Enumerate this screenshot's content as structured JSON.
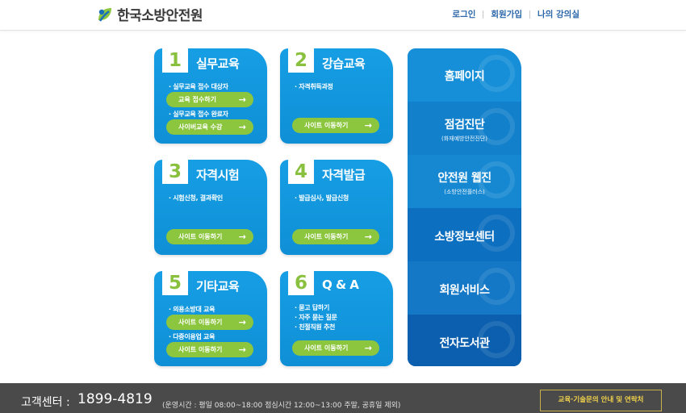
{
  "header": {
    "logo_text": "한국소방안전원",
    "nav": [
      "로그인",
      "회원가입",
      "나의 강의실"
    ]
  },
  "tiles": [
    {
      "num": "1",
      "title": "실무교육",
      "bullets": [
        "실무교육 접수 대상자",
        "실무교육 접수 완료자"
      ],
      "buttons": [
        "교육 접수하기",
        "사이버교육 수강"
      ]
    },
    {
      "num": "2",
      "title": "강습교육",
      "bullets": [
        "자격취득과정"
      ],
      "buttons": [
        "사이트 이동하기"
      ]
    },
    {
      "num": "3",
      "title": "자격시험",
      "bullets": [
        "시험신청, 결과확인"
      ],
      "buttons": [
        "사이트 이동하기"
      ]
    },
    {
      "num": "4",
      "title": "자격발급",
      "bullets": [
        "발급심사, 발급신청"
      ],
      "buttons": [
        "사이트 이동하기"
      ]
    },
    {
      "num": "5",
      "title": "기타교육",
      "bullets": [
        "의용소방대 교육",
        "다중이용업 교육"
      ],
      "buttons": [
        "사이트 이동하기",
        "사이트 이동하기"
      ]
    },
    {
      "num": "6",
      "title": "Q & A",
      "bullets": [
        "묻고 답하기",
        "자주 묻는 질문",
        "친절직원 추천"
      ],
      "buttons": [
        "사이트 이동하기"
      ]
    }
  ],
  "right_menu": [
    {
      "label": "홈페이지",
      "sub": ""
    },
    {
      "label": "점검진단",
      "sub": "(화재예방안전진단)"
    },
    {
      "label": "안전원 웹진",
      "sub": "(소방안전플러스)"
    },
    {
      "label": "소방정보센터",
      "sub": ""
    },
    {
      "label": "회원서비스",
      "sub": ""
    },
    {
      "label": "전자도서관",
      "sub": ""
    }
  ],
  "footer": {
    "cs_label": "고객센터 :",
    "phone": "1899-4819",
    "hours": "(운영시간 : 평일 08:00~18:00  점심시간 12:00~13:00  주말, 공휴일 제외)",
    "contact_button": "교육·기술문의 안내 및 연락처"
  },
  "colors": {
    "tile_blue": "#1199e0",
    "accent_green": "#8cc63f",
    "right_menu_blue": "#0e6fc1",
    "footer_gray": "#4a4a4a",
    "footer_button_yellow": "#f0d24a"
  }
}
